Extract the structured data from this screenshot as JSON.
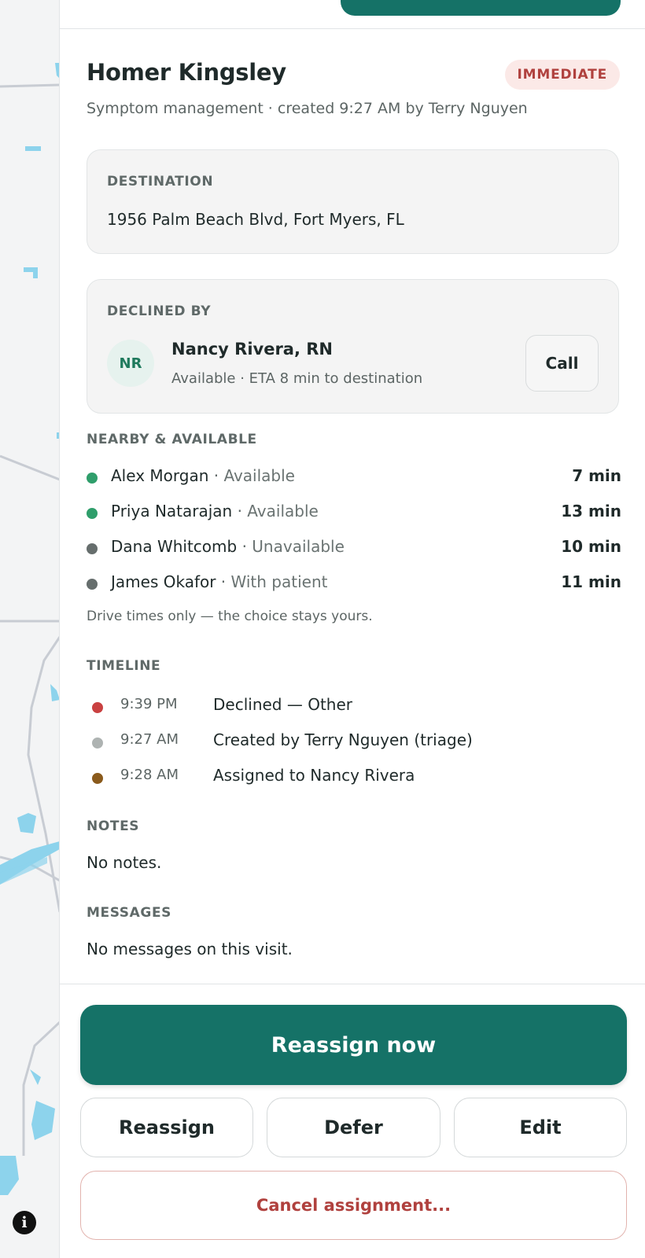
{
  "visit": {
    "patient_name": "Homer Kingsley",
    "priority_badge": "IMMEDIATE",
    "subtitle": "Symptom management · created 9:27 AM by Terry Nguyen"
  },
  "destination": {
    "label": "DESTINATION",
    "address": "1956 Palm Beach Blvd, Fort Myers, FL"
  },
  "declined_by": {
    "label": "DECLINED BY",
    "initials": "NR",
    "name": "Nancy Rivera, RN",
    "status": "Available · ETA 8 min to destination",
    "call_label": "Call"
  },
  "nearby": {
    "label": "NEARBY & AVAILABLE",
    "items": [
      {
        "name": "Alex Morgan",
        "sep": " · ",
        "status": "Available",
        "eta": "7 min",
        "color": "#2f9e6b"
      },
      {
        "name": "Priya Natarajan",
        "sep": " · ",
        "status": "Available",
        "eta": "13 min",
        "color": "#2f9e6b"
      },
      {
        "name": "Dana Whitcomb",
        "sep": " · ",
        "status": "Unavailable",
        "eta": "10 min",
        "color": "#666e6d"
      },
      {
        "name": "James Okafor",
        "sep": " · ",
        "status": "With patient",
        "eta": "11 min",
        "color": "#666e6d"
      }
    ],
    "hint": "Drive times only — the choice stays yours."
  },
  "timeline": {
    "label": "TIMELINE",
    "events": [
      {
        "time": "9:39 PM",
        "text": "Declined — Other",
        "color": "#c94141"
      },
      {
        "time": "9:27 AM",
        "text": "Created by Terry Nguyen (triage)",
        "color": "#aeb3b2"
      },
      {
        "time": "9:28 AM",
        "text": "Assigned to Nancy Rivera",
        "color": "#8a5a1c"
      }
    ]
  },
  "notes": {
    "label": "NOTES",
    "text": "No notes."
  },
  "messages": {
    "label": "MESSAGES",
    "text": "No messages on this visit."
  },
  "actions": {
    "primary": "Reassign now",
    "reassign": "Reassign",
    "defer": "Defer",
    "edit": "Edit",
    "cancel": "Cancel assignment..."
  },
  "map": {
    "info_icon": "info-icon"
  },
  "colors": {
    "primary": "#157267",
    "danger": "#b0413e",
    "badge_bg": "#fbe9e7",
    "water": "#8dd3ec"
  }
}
